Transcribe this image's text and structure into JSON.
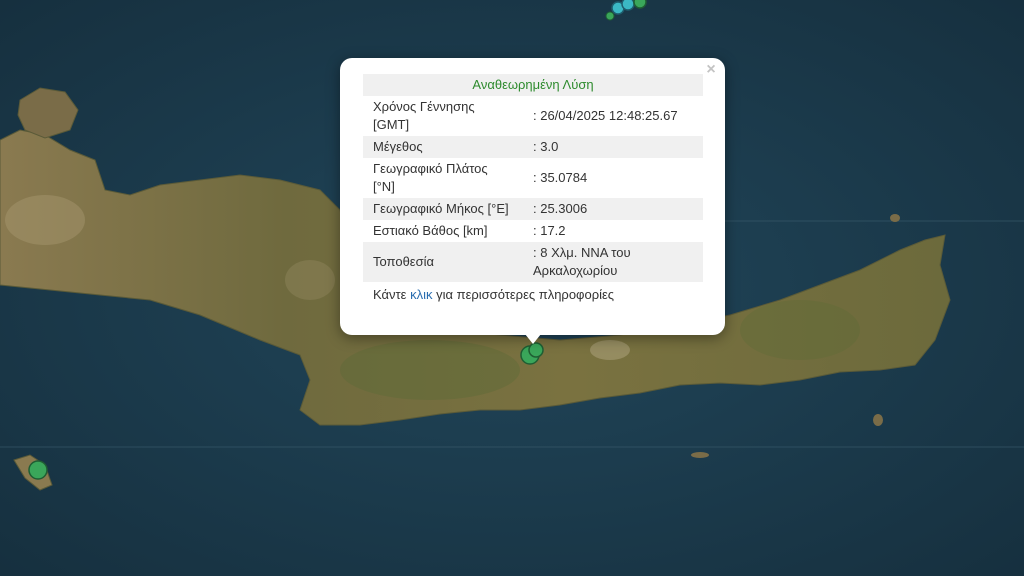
{
  "popup": {
    "close_label": "×",
    "header": "Αναθεωρημένη Λύση",
    "rows": [
      {
        "label": "Χρόνος Γέννησης [GMT]",
        "value": ": 26/04/2025 12:48:25.67"
      },
      {
        "label": "Μέγεθος",
        "value": ": 3.0"
      },
      {
        "label": "Γεωγραφικό Πλάτος [°N]",
        "value": ": 35.0784"
      },
      {
        "label": "Γεωγραφικό Μήκος [°E]",
        "value": ": 25.3006"
      },
      {
        "label": "Εστιακό Βάθος [km]",
        "value": ": 17.2"
      },
      {
        "label": "Τοποθεσία",
        "value": ": 8 Χλμ. ΝΝΑ του Αρκαλοχωρίου"
      }
    ],
    "footer_before": "Κάντε ",
    "footer_link": "κλικ",
    "footer_after": " για περισσότερες πληροφορίες"
  },
  "map": {
    "sea_color": "#1b3a4c",
    "land_color": "#6f6a3e",
    "marker_color": "#3aa65a",
    "marker_alt_color": "#3bb8c4"
  }
}
